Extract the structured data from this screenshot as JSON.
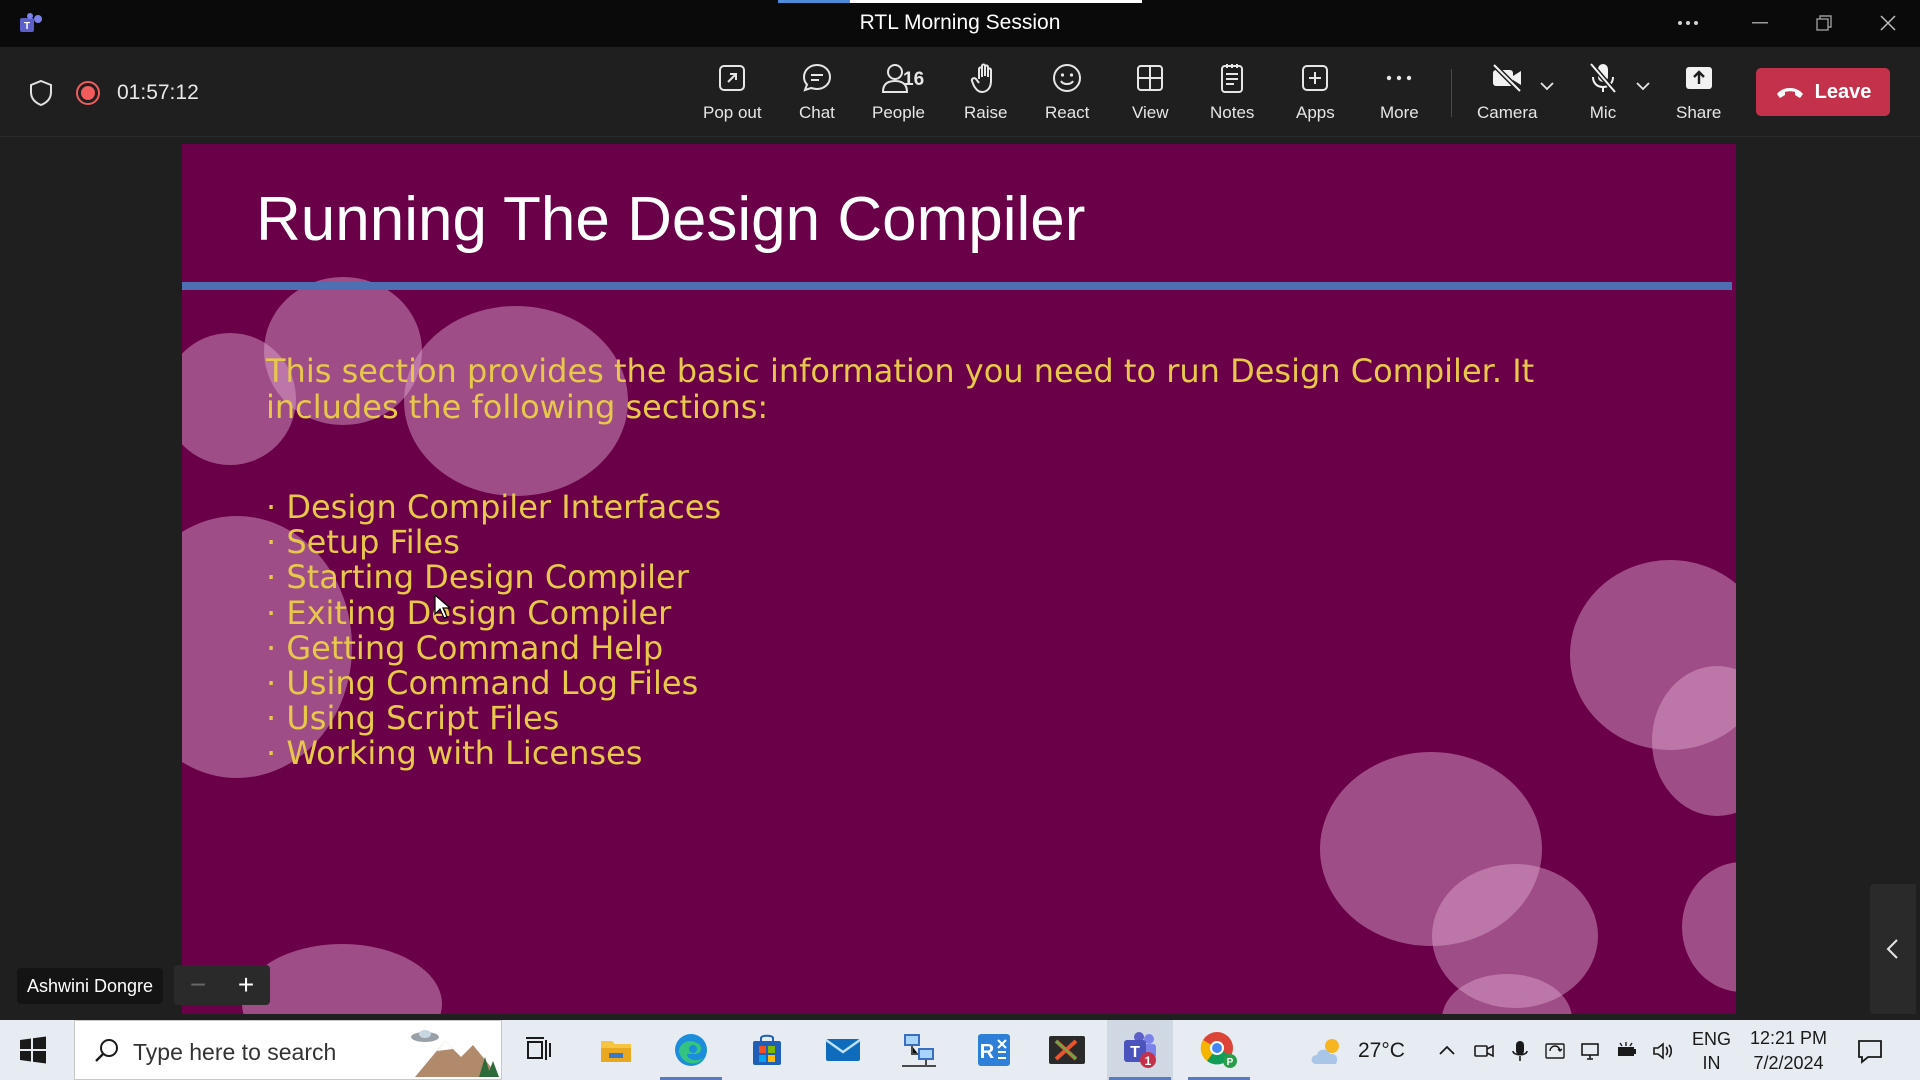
{
  "window": {
    "title": "RTL Morning Session"
  },
  "meeting": {
    "timer": "01:57:12",
    "people_count": "16",
    "buttons": {
      "pop_out": "Pop out",
      "chat": "Chat",
      "people": "People",
      "raise": "Raise",
      "react": "React",
      "view": "View",
      "notes": "Notes",
      "apps": "Apps",
      "more": "More",
      "camera": "Camera",
      "mic": "Mic",
      "share": "Share",
      "leave": "Leave"
    },
    "presenter_name": "Ashwini Dongre",
    "zoom_minus": "−",
    "zoom_plus": "+"
  },
  "slide": {
    "title": "Running The Design Compiler",
    "intro": "This section provides the basic information you need to run Design Compiler. It includes the following sections:",
    "bullets": [
      "Design Compiler Interfaces",
      "Setup Files",
      "Starting Design Compiler",
      "Exiting Design Compiler",
      "Getting Command Help",
      "Using Command Log Files",
      "Using Script Files",
      "Working with Licenses"
    ]
  },
  "taskbar": {
    "search_placeholder": "Type here to search",
    "teams_badge": "1",
    "weather_temp": "27°C",
    "lang_line1": "ENG",
    "lang_line2": "IN",
    "time": "12:21 PM",
    "date": "7/2/2024"
  },
  "colors": {
    "slide_bg": "#6a0048",
    "slide_text": "#e8c84a",
    "leave_red": "#c4314b",
    "rule_blue": "#4f6fb3"
  }
}
